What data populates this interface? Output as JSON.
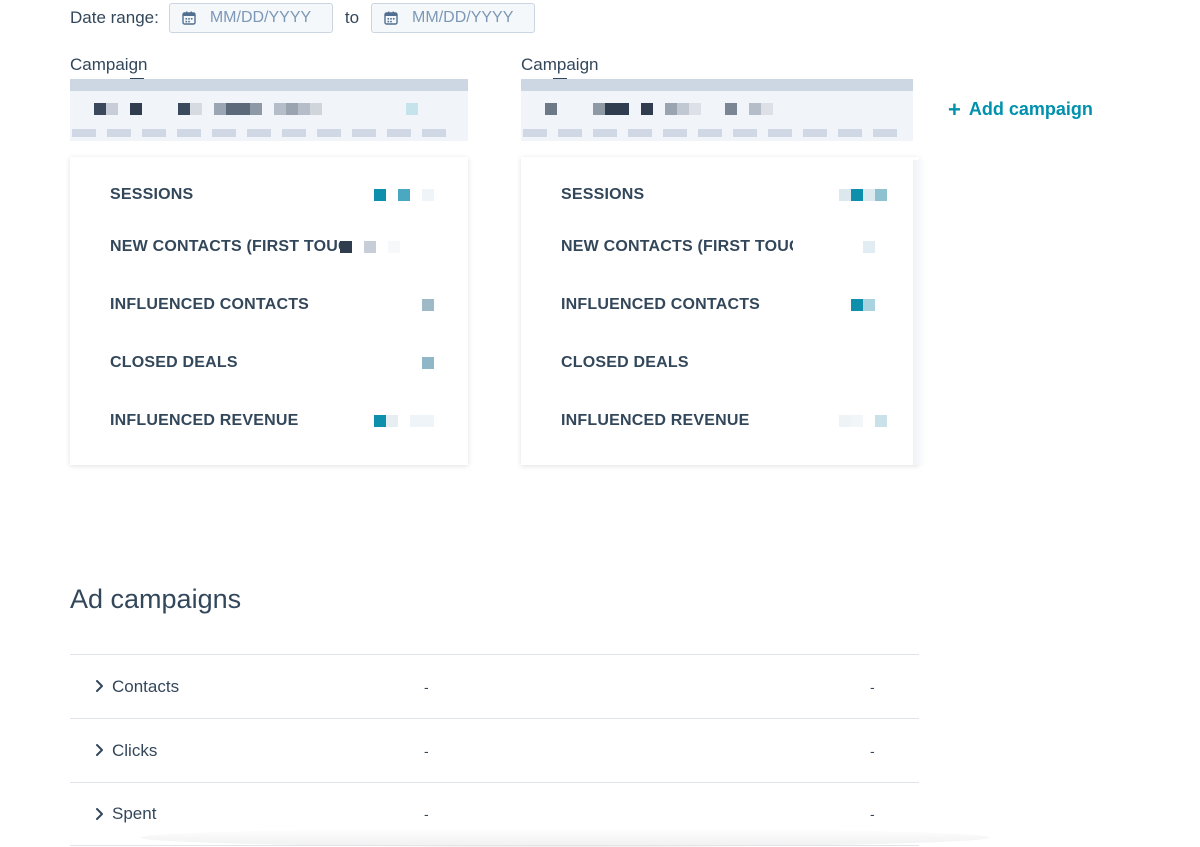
{
  "date_range": {
    "label": "Date range:",
    "start_placeholder": "MM/DD/YYYY",
    "to_label": "to",
    "end_placeholder": "MM/DD/YYYY"
  },
  "campaigns": [
    {
      "label": "Campaign",
      "stats": [
        {
          "label": "SESSIONS"
        },
        {
          "label": "NEW CONTACTS (FIRST TOUCH)"
        },
        {
          "label": "INFLUENCED CONTACTS"
        },
        {
          "label": "CLOSED DEALS"
        },
        {
          "label": "INFLUENCED REVENUE"
        }
      ]
    },
    {
      "label": "Campaign",
      "stats": [
        {
          "label": "SESSIONS"
        },
        {
          "label": "NEW CONTACTS (FIRST TOUCH)"
        },
        {
          "label": "INFLUENCED CONTACTS"
        },
        {
          "label": "CLOSED DEALS"
        },
        {
          "label": "INFLUENCED REVENUE"
        }
      ]
    }
  ],
  "add_campaign": {
    "label": "Add campaign",
    "icon": "plus-icon"
  },
  "ad_campaigns": {
    "title": "Ad campaigns",
    "rows": [
      {
        "label": "Contacts",
        "value_1": "-",
        "value_2": "-"
      },
      {
        "label": "Clicks",
        "value_1": "-",
        "value_2": "-"
      },
      {
        "label": "Spent",
        "value_1": "-",
        "value_2": "-"
      }
    ]
  },
  "colors": {
    "accent": "#0091ae",
    "text": "#33475b",
    "placeholder": "#7c98b6",
    "border": "#cbd6e2"
  }
}
